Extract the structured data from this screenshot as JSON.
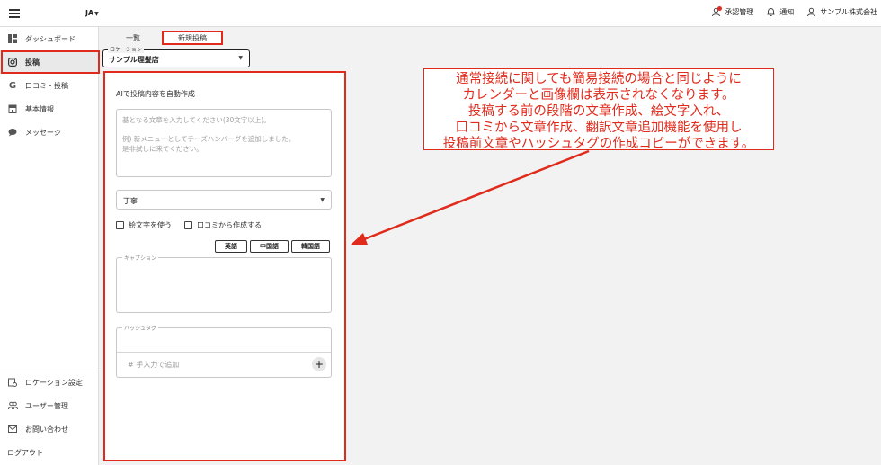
{
  "header": {
    "lang": "JA",
    "approval": "承認管理",
    "notification": "通知",
    "company": "サンプル株式会社"
  },
  "sidebar": {
    "items": [
      {
        "label": "ダッシュボード",
        "icon": "dashboard-icon"
      },
      {
        "label": "投稿",
        "icon": "instagram-icon"
      },
      {
        "label": "口コミ・投稿",
        "icon": "google-icon"
      },
      {
        "label": "基本情報",
        "icon": "store-icon"
      },
      {
        "label": "メッセージ",
        "icon": "chat-icon"
      }
    ],
    "bottom": [
      {
        "label": "ロケーション設定",
        "icon": "location-settings-icon"
      },
      {
        "label": "ユーザー管理",
        "icon": "users-icon"
      },
      {
        "label": "お問い合わせ",
        "icon": "mail-icon"
      },
      {
        "label": "ログアウト"
      }
    ]
  },
  "tabs": {
    "list": "一覧",
    "new": "新規投稿"
  },
  "location": {
    "label": "ロケーション",
    "value": "サンプル理髪店"
  },
  "form": {
    "title": "AIで投稿内容を自動作成",
    "placeholder_line1": "基となる文章を入力してください(30文字以上)。",
    "placeholder_line2": "例) 新メニューとしてチーズハンバーグを追加しました。",
    "placeholder_line3": "是非試しに来てください。",
    "tone": "丁寧",
    "check_emoji": "絵文字を使う",
    "check_review": "口コミから作成する",
    "btn_en": "英語",
    "btn_zh": "中国語",
    "btn_ko": "韓国語",
    "caption_label": "キャプション",
    "hashtag_label": "ハッシュタグ",
    "hashtag_placeholder": "# 手入力で追加"
  },
  "annotation": {
    "line1": "通常接続に関しても簡易接続の場合と同じように",
    "line2": "カレンダーと画像欄は表示されなくなります。",
    "line3": "投稿する前の段階の文章作成、絵文字入れ、",
    "line4": "口コミから文章作成、翻訳文章追加機能を使用し",
    "line5": "投稿前文章やハッシュタグの作成コピーができます。"
  },
  "colors": {
    "accent": "#e02b1c"
  }
}
